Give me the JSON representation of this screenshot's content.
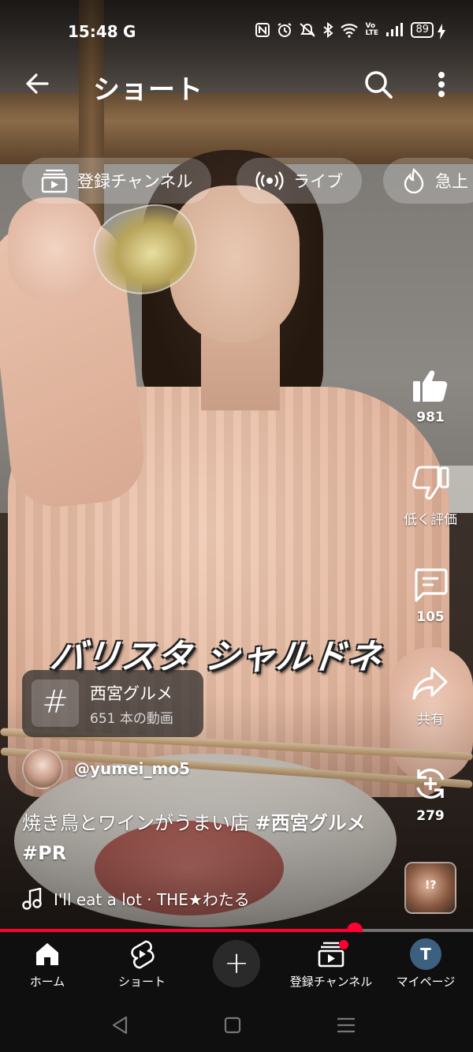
{
  "status_bar": {
    "time": "15:48",
    "g_label": "G",
    "icons": [
      "nfc-icon",
      "alarm-icon",
      "mute-icon",
      "bluetooth-icon",
      "wifi-icon",
      "volte-icon",
      "signal-icon"
    ],
    "volte": "Vo LTE",
    "battery": "89"
  },
  "app_bar": {
    "title": "ショート"
  },
  "chips": [
    {
      "label": "登録チャンネル",
      "icon": "subscriptions-icon"
    },
    {
      "label": "ライブ",
      "icon": "live-icon"
    },
    {
      "label": "急上",
      "icon": "trending-icon"
    }
  ],
  "rail": {
    "like_count": "981",
    "dislike_label": "低く評価",
    "comment_count": "105",
    "share_label": "共有",
    "remix_count": "279"
  },
  "caption": "バリスタ シャルドネ",
  "hashtag_card": {
    "symbol": "#",
    "name": "西宮グルメ",
    "count": "651 本の動画"
  },
  "channel": {
    "handle": "@yumei_mo5"
  },
  "description": {
    "text": "焼き鳥とワインがうまい店 ",
    "tag1": "#西宮グルメ",
    "tag2": "#PR"
  },
  "music": {
    "text": "I'll eat a lot · THE★わたる"
  },
  "thumbnail": {
    "overlay": "!?"
  },
  "progress": {
    "fraction": 0.75,
    "color": "#ff0033"
  },
  "bottom_nav": {
    "home": "ホーム",
    "shorts": "ショート",
    "create": "+",
    "subscriptions": "登録チャンネル",
    "my_page": "マイページ",
    "avatar_letter": "T"
  }
}
